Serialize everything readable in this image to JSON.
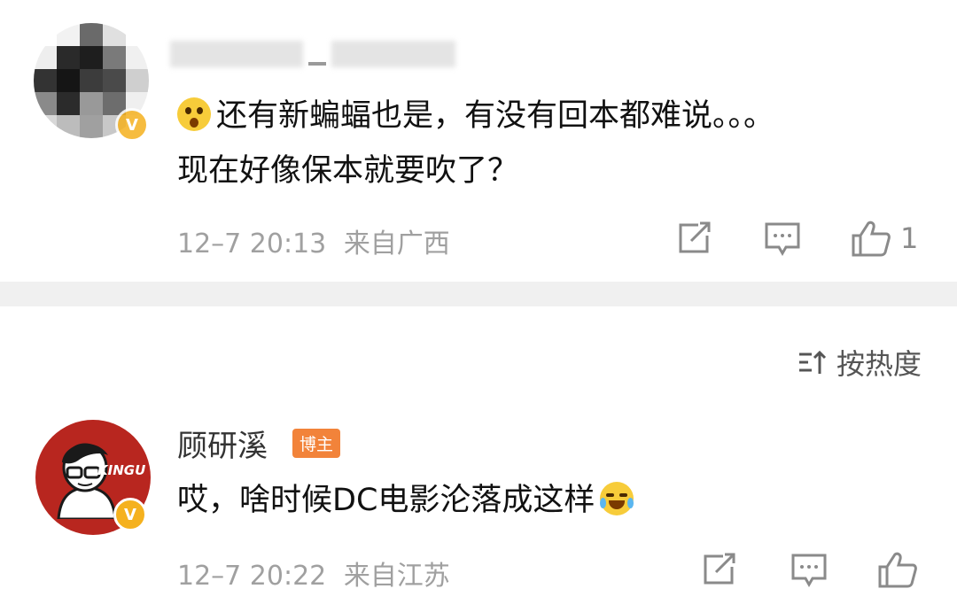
{
  "comments": [
    {
      "username": "",
      "username_blurred": true,
      "avatar": "pixelated-avatar",
      "verified_badge": "v-badge",
      "emoji": "surprised-face",
      "text": "还有新蝙蝠也是，有没有回本都难说。。。 现在好像保本就要吹了？",
      "timestamp": "12–7 20:13",
      "location": "来自广西",
      "actions": {
        "share_icon": "share-icon",
        "comment_icon": "comment-icon",
        "like_icon": "thumbs-up-icon",
        "like_count": "1"
      }
    },
    {
      "username": "顾研溪",
      "tag": "博主",
      "avatar": "kingu-avatar",
      "avatar_text": "KINGU",
      "verified_badge": "v-badge",
      "text": "哎，啥时候DC电影沦落成这样",
      "emoji": "crying-laughing-face",
      "timestamp": "12–7 20:22",
      "location": "来自江苏",
      "actions": {
        "share_icon": "share-icon",
        "comment_icon": "comment-icon",
        "like_icon": "thumbs-up-icon",
        "like_count": ""
      }
    }
  ],
  "sort": {
    "icon": "sort-icon",
    "label": "按热度"
  },
  "colors": {
    "accent_tag": "#f2833a",
    "badge": "#f5b11e",
    "meta_text": "#a0a0a0",
    "divider": "#f0f0f0",
    "avatar_red": "#b8261f"
  }
}
